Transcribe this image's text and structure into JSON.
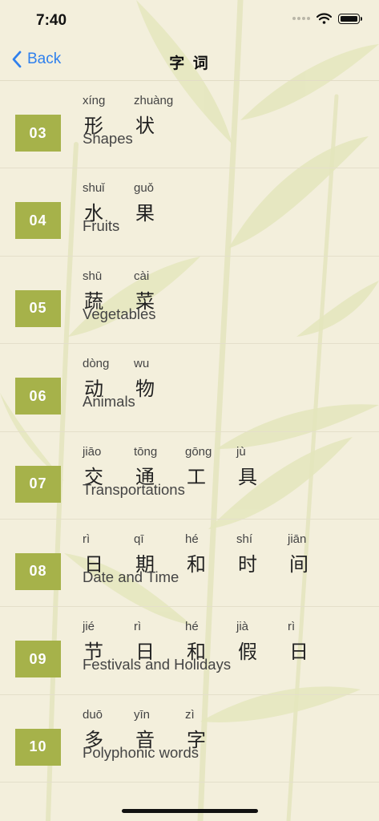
{
  "status": {
    "time": "7:40"
  },
  "nav": {
    "back_label": "Back",
    "title": "字 词"
  },
  "lessons": [
    {
      "number": "03",
      "english": "Shapes",
      "chars": [
        {
          "pinyin": "xíng",
          "hanzi": "形"
        },
        {
          "pinyin": "zhuàng",
          "hanzi": "状"
        }
      ]
    },
    {
      "number": "04",
      "english": "Fruits",
      "chars": [
        {
          "pinyin": "shuǐ",
          "hanzi": "水"
        },
        {
          "pinyin": "guǒ",
          "hanzi": "果"
        }
      ]
    },
    {
      "number": "05",
      "english": "Vegetables",
      "chars": [
        {
          "pinyin": "shū",
          "hanzi": "蔬"
        },
        {
          "pinyin": "cài",
          "hanzi": "菜"
        }
      ]
    },
    {
      "number": "06",
      "english": "Animals",
      "chars": [
        {
          "pinyin": "dòng",
          "hanzi": "动"
        },
        {
          "pinyin": "wu",
          "hanzi": "物"
        }
      ]
    },
    {
      "number": "07",
      "english": "Transportations",
      "chars": [
        {
          "pinyin": "jiāo",
          "hanzi": "交"
        },
        {
          "pinyin": "tōng",
          "hanzi": "通"
        },
        {
          "pinyin": "gōng",
          "hanzi": "工"
        },
        {
          "pinyin": "jù",
          "hanzi": "具"
        }
      ]
    },
    {
      "number": "08",
      "english": "Date and Time",
      "chars": [
        {
          "pinyin": "rì",
          "hanzi": "日"
        },
        {
          "pinyin": "qī",
          "hanzi": "期"
        },
        {
          "pinyin": "hé",
          "hanzi": "和"
        },
        {
          "pinyin": "shí",
          "hanzi": "时"
        },
        {
          "pinyin": "jiān",
          "hanzi": "间"
        }
      ]
    },
    {
      "number": "09",
      "english": "Festivals and Holidays",
      "chars": [
        {
          "pinyin": "jié",
          "hanzi": "节"
        },
        {
          "pinyin": "rì",
          "hanzi": "日"
        },
        {
          "pinyin": "hé",
          "hanzi": "和"
        },
        {
          "pinyin": "jià",
          "hanzi": "假"
        },
        {
          "pinyin": "rì",
          "hanzi": "日"
        }
      ]
    },
    {
      "number": "10",
      "english": "Polyphonic words",
      "chars": [
        {
          "pinyin": "duō",
          "hanzi": "多"
        },
        {
          "pinyin": "yīn",
          "hanzi": "音"
        },
        {
          "pinyin": "zì",
          "hanzi": "字"
        }
      ]
    }
  ],
  "colors": {
    "badge": "#a6b24a",
    "background": "#f3efdc",
    "accent": "#2f80ed"
  },
  "icons": {
    "back": "chevron-left-icon",
    "wifi": "wifi-icon",
    "battery": "battery-icon",
    "signal": "signal-dots-icon"
  }
}
